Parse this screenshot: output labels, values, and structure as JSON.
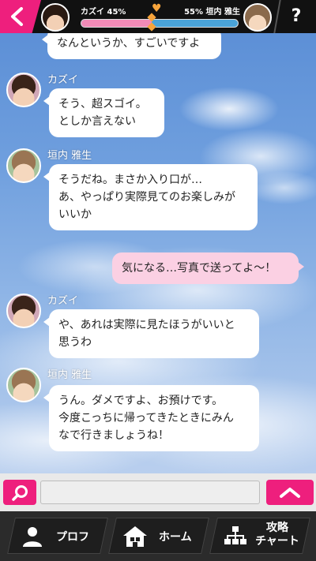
{
  "header": {
    "left_meter": "カズイ 45%",
    "right_meter": "55% 垣内 雅生",
    "affection_left_percent": 45,
    "help_label": "?"
  },
  "messages": [
    {
      "sender": "",
      "side": "left",
      "lines": [
        "なんというか、すごいですよ"
      ]
    },
    {
      "sender": "カズイ",
      "side": "left",
      "lines": [
        "そう、超スゴイ。",
        "としか言えない"
      ]
    },
    {
      "sender": "垣内 雅生",
      "side": "left",
      "lines": [
        "そうだね。まさか入り口が…",
        "あ、やっぱり実際見てのお楽しみが",
        "いいか"
      ]
    },
    {
      "sender": "",
      "side": "right",
      "lines": [
        "気になる…写真で送ってよ〜！"
      ]
    },
    {
      "sender": "カズイ",
      "side": "left",
      "lines": [
        "や、あれは実際に見たほうがいいと",
        "思うわ"
      ]
    },
    {
      "sender": "垣内 雅生",
      "side": "left",
      "lines": [
        "うん。ダメですよ、お預けです。",
        "今度こっちに帰ってきたときにみん",
        "なで行きましょうね！"
      ]
    }
  ],
  "input": {
    "placeholder": ""
  },
  "nav": {
    "profile_label": "プロフ",
    "home_label": "ホーム",
    "chart_label_line1": "攻略",
    "chart_label_line2": "チャート"
  },
  "colors": {
    "accent": "#ee1f7d",
    "bubble_outgoing": "#fbd0e3",
    "bubble_incoming": "#ffffff",
    "nav_bg": "#2b2b2b"
  }
}
